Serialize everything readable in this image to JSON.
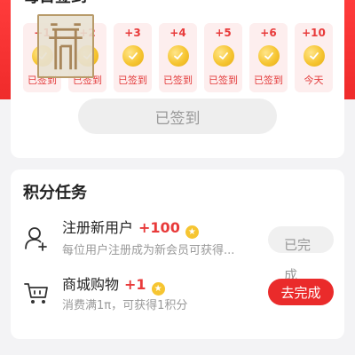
{
  "signin": {
    "title": "每日签到",
    "days": [
      {
        "points": "+1",
        "label": "已签到"
      },
      {
        "points": "+2",
        "label": "已签到"
      },
      {
        "points": "+3",
        "label": "已签到"
      },
      {
        "points": "+4",
        "label": "已签到"
      },
      {
        "points": "+5",
        "label": "已签到"
      },
      {
        "points": "+6",
        "label": "已签到"
      },
      {
        "points": "+10",
        "label": "今天"
      }
    ],
    "button_label": "已签到"
  },
  "tasks": {
    "title": "积分任务",
    "items": [
      {
        "icon": "add-user-icon",
        "title": "注册新用户",
        "points": "+100",
        "description": "每位用户注册成为新会员可获得...",
        "button_label": "已完成"
      },
      {
        "icon": "shopping-cart-icon",
        "title": "商城购物",
        "points": "+1",
        "description": "消费满1π，可获得1积分",
        "button_label": "去完成"
      }
    ]
  },
  "colors": {
    "accent": "#ea2b2b",
    "coin": "#f6c531",
    "day_bg": "#fdeeee"
  }
}
